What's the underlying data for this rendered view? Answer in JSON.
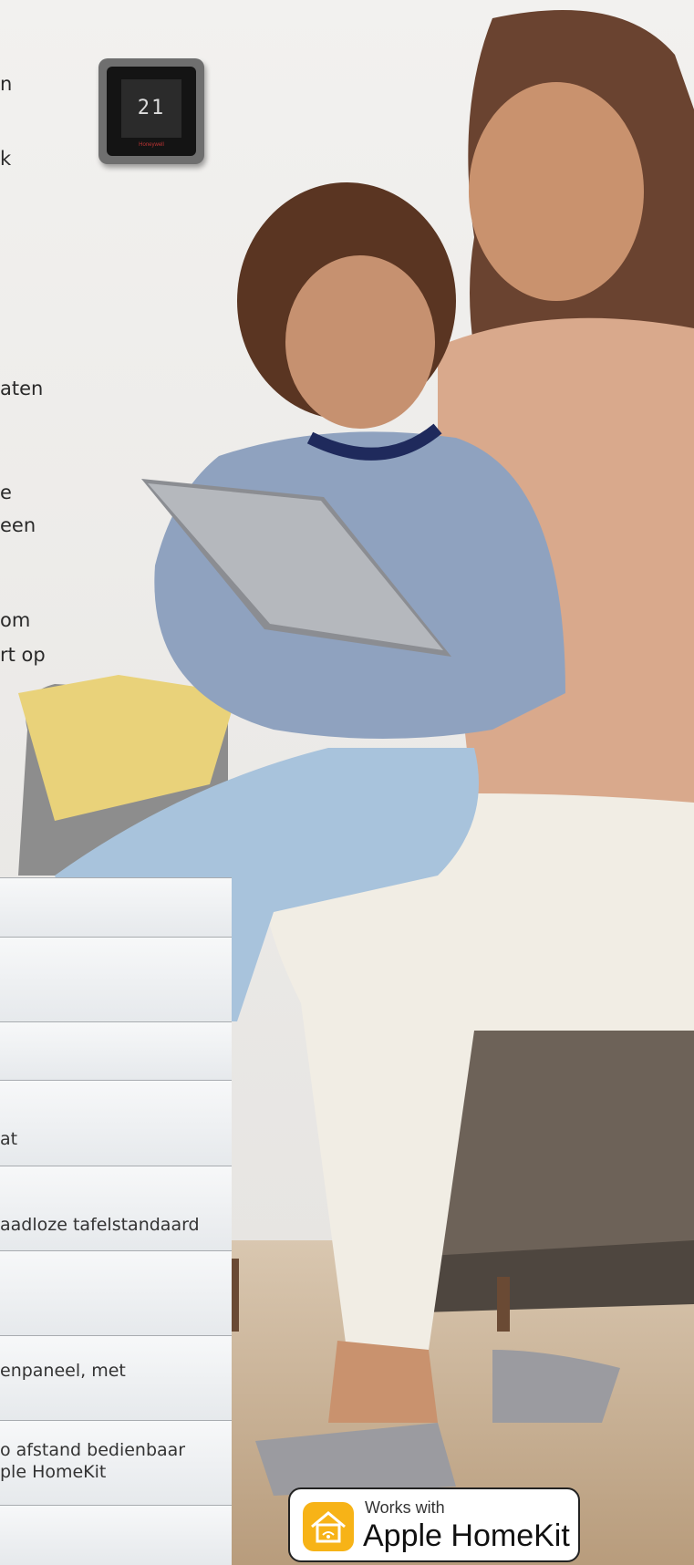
{
  "left_text_fragments": [
    "n",
    "k",
    "aten",
    "e",
    "een",
    "om",
    "rt op"
  ],
  "thermostat": {
    "display": "21",
    "top_text": "",
    "brand": "Honeywell"
  },
  "table_rows": [
    "",
    "",
    "",
    "at",
    "aadloze tafelstandaard",
    "",
    "enpaneel, met",
    "o afstand bedienbaar\nple HomeKit",
    ""
  ],
  "badge": {
    "small": "Works with",
    "big": "Apple HomeKit",
    "icon": "home-icon"
  }
}
